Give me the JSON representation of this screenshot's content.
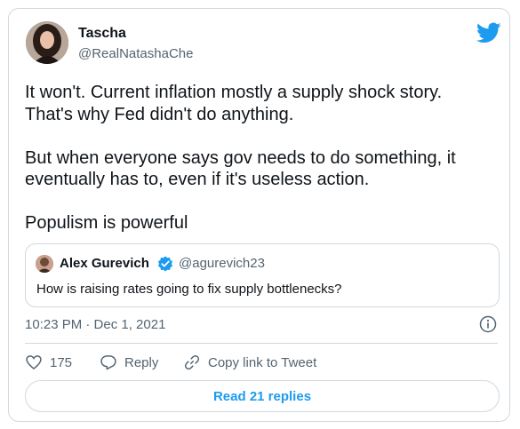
{
  "author": {
    "name": "Tascha",
    "handle": "@RealNatashaChe"
  },
  "icons": {
    "logo": "twitter-bird-icon",
    "verified": "verified-badge-icon",
    "info": "info-icon",
    "like": "heart-icon",
    "reply": "reply-bubble-icon",
    "copy": "link-icon"
  },
  "colors": {
    "brand": "#1d9bf0",
    "secondary_text": "#536471",
    "border": "#cfd9de"
  },
  "tweet": {
    "text": "It won't. Current inflation mostly a supply shock story.\nThat's why Fed didn't do anything.\n\nBut when everyone says gov needs to do something, it\neventually has to, even if it's useless action.\n\nPopulism is powerful"
  },
  "quote": {
    "name": "Alex Gurevich",
    "handle": "@agurevich23",
    "text": "How is raising rates going to fix supply bottlenecks?"
  },
  "timestamp": "10:23 PM · Dec 1, 2021",
  "actions": {
    "likes": "175",
    "reply": "Reply",
    "copy_link": "Copy link to Tweet"
  },
  "read_replies": "Read 21 replies"
}
